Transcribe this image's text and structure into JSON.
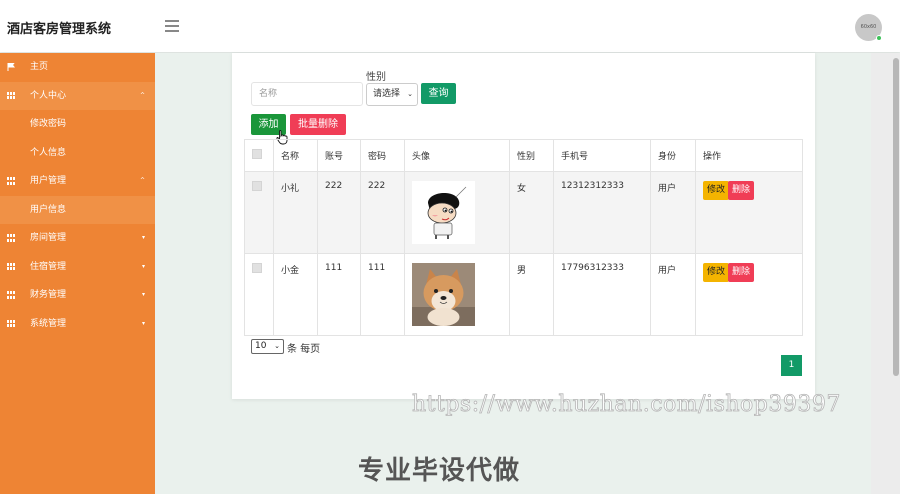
{
  "header": {
    "title": "酒店客房管理系统",
    "avatar_text": "60x60"
  },
  "sidebar": {
    "items": [
      {
        "label": "主页",
        "icon": "flag-icon"
      },
      {
        "label": "个人中心",
        "icon": "grid-icon",
        "caret": "^"
      },
      {
        "label": "修改密码"
      },
      {
        "label": "个人信息"
      },
      {
        "label": "用户管理",
        "icon": "grid-icon",
        "caret": "^"
      },
      {
        "label": "用户信息"
      },
      {
        "label": "房间管理",
        "icon": "grid-icon",
        "caret": "▾"
      },
      {
        "label": "住宿管理",
        "icon": "grid-icon",
        "caret": "▾"
      },
      {
        "label": "财务管理",
        "icon": "grid-icon",
        "caret": "▾"
      },
      {
        "label": "系统管理",
        "icon": "grid-icon",
        "caret": "▾"
      }
    ]
  },
  "search": {
    "name_placeholder": "名称",
    "gender_label": "性别",
    "gender_value": "请选择",
    "query_label": "查询"
  },
  "toolbar": {
    "add_label": "添加",
    "bulk_delete_label": "批量删除"
  },
  "table": {
    "columns": [
      "名称",
      "账号",
      "密码",
      "头像",
      "性别",
      "手机号",
      "身份",
      "操作"
    ],
    "rows": [
      {
        "name": "小礼",
        "account": "222",
        "password": "222",
        "avatar": "cartoon-boy-avatar",
        "gender": "女",
        "phone": "12312312333",
        "role": "用户",
        "edit": "修改",
        "delete": "删除"
      },
      {
        "name": "小金",
        "account": "111",
        "password": "111",
        "avatar": "shiba-dog-avatar",
        "gender": "男",
        "phone": "17796312333",
        "role": "用户",
        "edit": "修改",
        "delete": "删除"
      }
    ]
  },
  "pagination": {
    "page_size": "10",
    "per_page_label": "条 每页",
    "current_page": "1"
  },
  "watermarks": {
    "url": "https://www.huzhan.com/ishop39397",
    "text": "专业毕设代做"
  },
  "colors": {
    "sidebar": "#ee8434",
    "primary": "#129a67",
    "add": "#1a963a",
    "danger": "#f03d56",
    "warning": "#f4b400"
  }
}
